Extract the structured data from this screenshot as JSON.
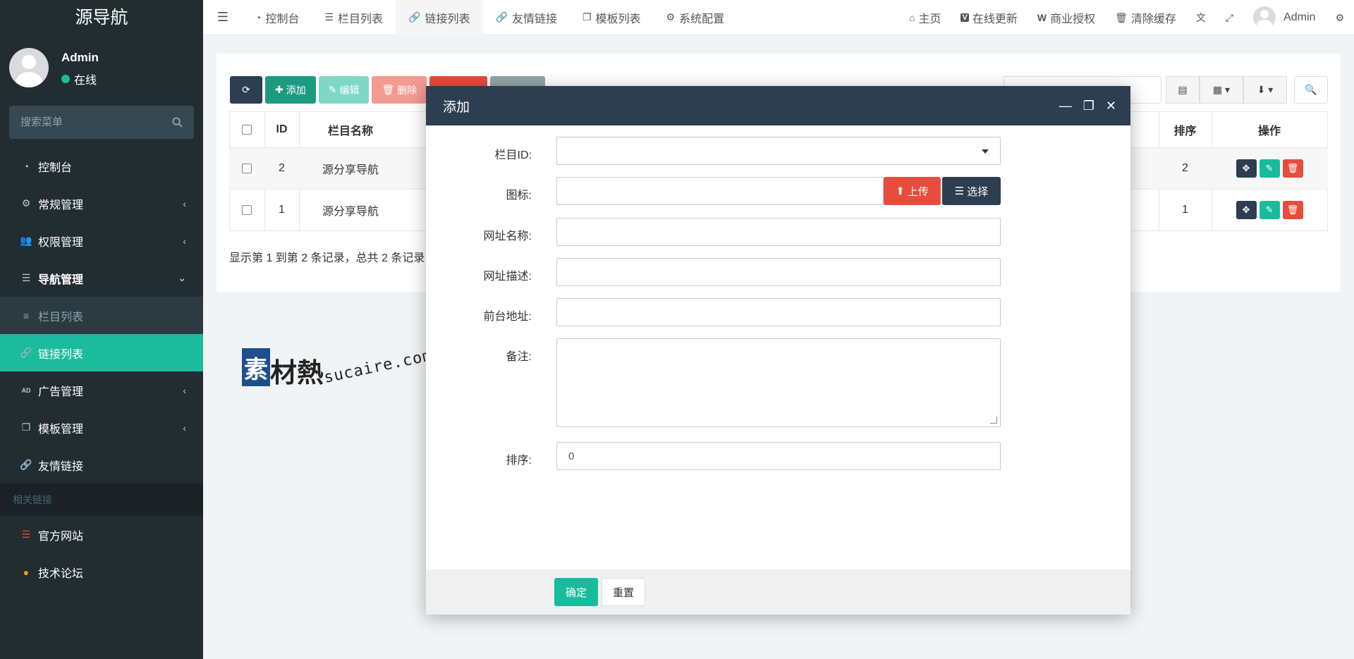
{
  "sidebar": {
    "logo": "源导航",
    "user_name": "Admin",
    "user_status": "在线",
    "search_placeholder": "搜索菜单",
    "items": [
      {
        "label": "控制台"
      },
      {
        "label": "常规管理"
      },
      {
        "label": "权限管理"
      },
      {
        "label": "导航管理"
      },
      {
        "label": "栏目列表"
      },
      {
        "label": "链接列表"
      },
      {
        "label": "广告管理"
      },
      {
        "label": "模板管理"
      },
      {
        "label": "友情链接"
      }
    ],
    "section_header": "相关链接",
    "links": [
      {
        "label": "官方网站"
      },
      {
        "label": "技术论坛"
      }
    ]
  },
  "topnav": {
    "tabs": [
      {
        "label": "控制台"
      },
      {
        "label": "栏目列表"
      },
      {
        "label": "链接列表"
      },
      {
        "label": "友情链接"
      },
      {
        "label": "模板列表"
      },
      {
        "label": "系统配置"
      }
    ],
    "right": [
      {
        "label": "主页"
      },
      {
        "label": "在线更新"
      },
      {
        "label": "商业授权"
      },
      {
        "label": "清除缓存"
      }
    ],
    "user": "Admin"
  },
  "toolbar": {
    "add": "添加",
    "edit": "编辑",
    "delete": "删除"
  },
  "table": {
    "headers": {
      "id": "ID",
      "name": "栏目名称",
      "sort": "排序",
      "ops": "操作"
    },
    "rows": [
      {
        "id": "2",
        "name": "源分享导航",
        "sort": "2"
      },
      {
        "id": "1",
        "name": "源分享导航",
        "sort": "1"
      }
    ],
    "footer": "显示第 1 到第 2 条记录，总共 2 条记录"
  },
  "watermark": {
    "box": "素",
    "text": "材熱",
    "url": "sucaire.com"
  },
  "modal": {
    "title": "添加",
    "fields": {
      "category_label": "栏目ID:",
      "icon_label": "图标:",
      "upload_label": "上传",
      "choose_label": "选择",
      "name_label": "网址名称:",
      "desc_label": "网址描述:",
      "url_label": "前台地址:",
      "remark_label": "备注:",
      "sort_label": "排序:",
      "sort_value": "0"
    },
    "confirm": "确定",
    "reset": "重置"
  },
  "colors": {
    "sidebar_bg": "#222d32",
    "accent": "#18bc9c",
    "modal_head": "#2c3e50",
    "danger": "#e74c3c"
  }
}
